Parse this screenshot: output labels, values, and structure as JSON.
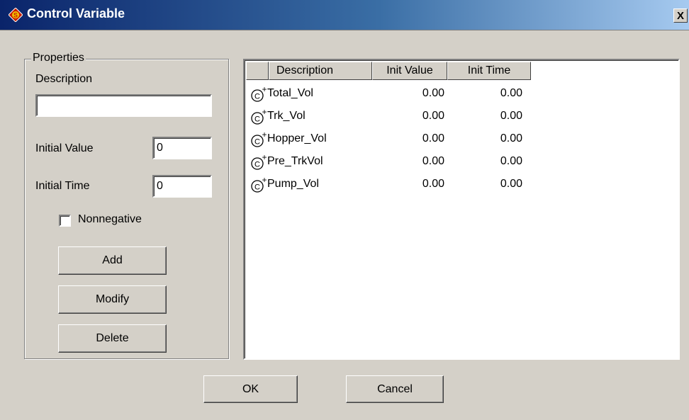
{
  "window": {
    "title": "Control Variable",
    "close_label": "X",
    "app_icon": "app-diamond-icon",
    "accent_color": "#0a246a"
  },
  "properties": {
    "group_label": "Properties",
    "description_label": "Description",
    "description_value": "",
    "initial_value_label": "Initial Value",
    "initial_value": "0",
    "initial_time_label": "Initial Time",
    "initial_time": "0",
    "nonnegative_label": "Nonnegative",
    "nonnegative_checked": false,
    "add_label": "Add",
    "modify_label": "Modify",
    "delete_label": "Delete"
  },
  "list": {
    "columns": [
      "Description",
      "Init Value",
      "Init Time"
    ],
    "item_icon": "control-variable-icon",
    "rows": [
      {
        "description": "Total_Vol",
        "init_value": "0.00",
        "init_time": "0.00"
      },
      {
        "description": "Trk_Vol",
        "init_value": "0.00",
        "init_time": "0.00"
      },
      {
        "description": "Hopper_Vol",
        "init_value": "0.00",
        "init_time": "0.00"
      },
      {
        "description": "Pre_TrkVol",
        "init_value": "0.00",
        "init_time": "0.00"
      },
      {
        "description": "Pump_Vol",
        "init_value": "0.00",
        "init_time": "0.00"
      }
    ]
  },
  "footer": {
    "ok_label": "OK",
    "cancel_label": "Cancel"
  }
}
